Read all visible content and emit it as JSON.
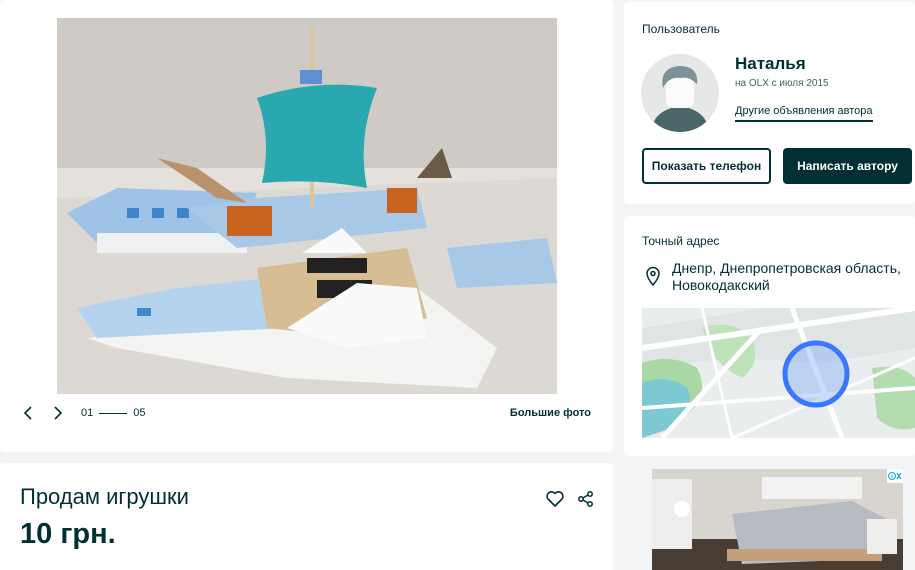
{
  "gallery": {
    "counter_current": "01",
    "counter_total": "05",
    "bigger_photo_label": "Большие фото"
  },
  "ad": {
    "title": "Продам игрушки",
    "price": "10 грн."
  },
  "user": {
    "section_label": "Пользователь",
    "name": "Наталья",
    "member_since": "на OLX с июля 2015",
    "other_ads_label": "Другие объявления автора",
    "show_phone_label": "Показать телефон",
    "write_author_label": "Написать автору"
  },
  "address": {
    "section_label": "Точный адрес",
    "location": "Днепр, Днепропетровская область, Новокодакский"
  },
  "icons": {
    "prev": "chevron-left-icon",
    "next": "chevron-right-icon",
    "favorite": "heart-icon",
    "share": "share-icon",
    "location": "map-pin-icon"
  },
  "colors": {
    "primary": "#002f34",
    "page_background": "#f2f4f5",
    "card_background": "#ffffff",
    "map_circle": "#3a77ff"
  }
}
